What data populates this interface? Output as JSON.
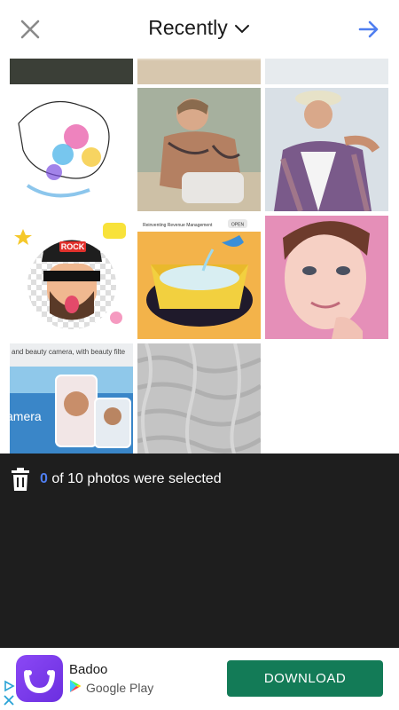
{
  "header": {
    "title": "Recently",
    "close_icon": "close-icon",
    "dropdown_icon": "chevron-down-icon",
    "next_icon": "arrow-right-icon",
    "accent_color": "#4f7ef0"
  },
  "gallery": {
    "items": [
      {
        "name": "photo-dark-partial"
      },
      {
        "name": "photo-beige-partial"
      },
      {
        "name": "photo-light-partial"
      },
      {
        "name": "photo-watercolor-portrait"
      },
      {
        "name": "photo-tattooed-man-crouching"
      },
      {
        "name": "photo-man-plaid-shirt"
      },
      {
        "name": "photo-sticker-rock-cap",
        "text": "ROCK"
      },
      {
        "name": "photo-ad-reinventing-revenue",
        "text": "Reinventing Revenue Management",
        "button": "OPEN"
      },
      {
        "name": "photo-girl-face"
      },
      {
        "name": "photo-beauty-camera-ad",
        "text1": "and beauty camera, with beauty filte",
        "text2": "amera"
      },
      {
        "name": "photo-gray-texture"
      }
    ]
  },
  "selection": {
    "count": "0",
    "text": "of 10 photos were selected",
    "trash_icon": "trash-icon"
  },
  "ad": {
    "app_name": "Badoo",
    "store": "Google Play",
    "download_label": "DOWNLOAD",
    "button_color": "#137b57"
  }
}
